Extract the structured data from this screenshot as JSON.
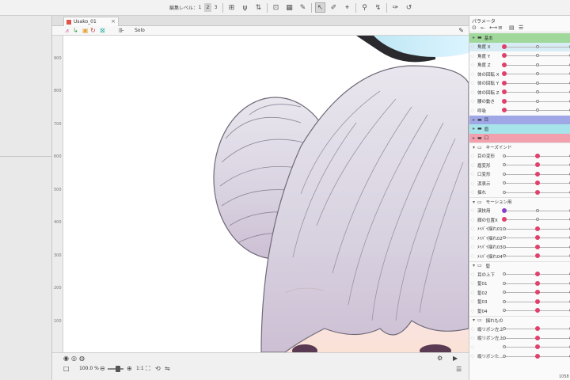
{
  "toolbar": {
    "edit_level_label": "編集レベル：",
    "levels": [
      "1",
      "2",
      "3"
    ]
  },
  "document": {
    "tab_title": "Usako_01",
    "tab_close": "×",
    "solo_label": "Solo"
  },
  "ruler": {
    "ticks": [
      "900",
      "800",
      "700",
      "600",
      "500",
      "400",
      "300",
      "200",
      "100"
    ]
  },
  "canvas_bottom": {
    "zoom_value": "100.0 %",
    "ratio_label": "1:1"
  },
  "params": {
    "title": "パラメータ",
    "groups": [
      {
        "type": "group",
        "label": "基本",
        "color": "green"
      },
      {
        "type": "param",
        "label": "角度 X",
        "selected": true,
        "knob": 0.0,
        "color": "pink"
      },
      {
        "type": "param",
        "label": "角度 Y",
        "knob": 0.0,
        "color": "pink"
      },
      {
        "type": "param",
        "label": "角度 Z",
        "knob": 0.0,
        "color": "pink"
      },
      {
        "type": "param",
        "label": "体の回転 X",
        "knob": 0.0,
        "color": "pink"
      },
      {
        "type": "param",
        "label": "体の回転 Y",
        "knob": 0.0,
        "color": "pink"
      },
      {
        "type": "param",
        "label": "体の回転 Z",
        "knob": 0.0,
        "color": "pink"
      },
      {
        "type": "param",
        "label": "腰の動き",
        "knob": 0.0,
        "color": "pink"
      },
      {
        "type": "param",
        "label": "呼吸",
        "knob": 0.0,
        "color": "pink"
      },
      {
        "type": "group",
        "label": "目",
        "color": "blue"
      },
      {
        "type": "group",
        "label": "眉",
        "color": "cyan"
      },
      {
        "type": "group",
        "label": "口",
        "color": "pink"
      },
      {
        "type": "subgroup",
        "label": "キーズインド"
      },
      {
        "type": "param",
        "label": "目の変形",
        "knob": 0.5,
        "color": "pink"
      },
      {
        "type": "param",
        "label": "眉変形",
        "knob": 0.5,
        "color": "pink"
      },
      {
        "type": "param",
        "label": "口変形",
        "knob": 0.5,
        "color": "pink"
      },
      {
        "type": "param",
        "label": "涙表示",
        "knob": 0.5,
        "color": "pink"
      },
      {
        "type": "param",
        "label": "揺れ",
        "knob": 0.5,
        "color": "pink"
      },
      {
        "type": "subgroup",
        "label": "モーション用"
      },
      {
        "type": "param",
        "label": "演技用",
        "knob": 0.0,
        "color": "purple"
      },
      {
        "type": "param",
        "label": "顔の位置X",
        "knob": 0.0,
        "color": "pink"
      },
      {
        "type": "param",
        "label": "ﾒｲﾊﾞｲ揺れ01",
        "knob": 0.5,
        "color": "pink"
      },
      {
        "type": "param",
        "label": "ﾒｲﾊﾞｲ揺れ02",
        "knob": 0.5,
        "color": "pink"
      },
      {
        "type": "param",
        "label": "ﾒｲﾊﾞｲ揺れ03",
        "knob": 0.5,
        "color": "pink"
      },
      {
        "type": "param",
        "label": "ﾒｲﾊﾞｲ揺れ04",
        "knob": 0.5,
        "color": "pink"
      },
      {
        "type": "subgroup",
        "label": "髪"
      },
      {
        "type": "param",
        "label": "耳の上下",
        "knob": 0.5,
        "color": "pink"
      },
      {
        "type": "param",
        "label": "髪01",
        "knob": 0.5,
        "color": "pink"
      },
      {
        "type": "param",
        "label": "髪02",
        "knob": 0.5,
        "color": "pink"
      },
      {
        "type": "param",
        "label": "髪03",
        "knob": 0.5,
        "color": "pink"
      },
      {
        "type": "param",
        "label": "髪04",
        "knob": 0.5,
        "color": "pink"
      },
      {
        "type": "subgroup",
        "label": "揺れもの"
      },
      {
        "type": "param",
        "label": "縦リボン左上",
        "knob": 0.5,
        "color": "pink"
      },
      {
        "type": "param",
        "label": "縦リボン左上",
        "knob": 0.5,
        "color": "pink"
      },
      {
        "type": "param",
        "label": "",
        "knob": 0.5,
        "color": "pink"
      },
      {
        "type": "param",
        "label": "縦リボンた...",
        "knob": 0.5,
        "color": "pink"
      }
    ]
  },
  "statusbar": {
    "coords": "1058"
  }
}
